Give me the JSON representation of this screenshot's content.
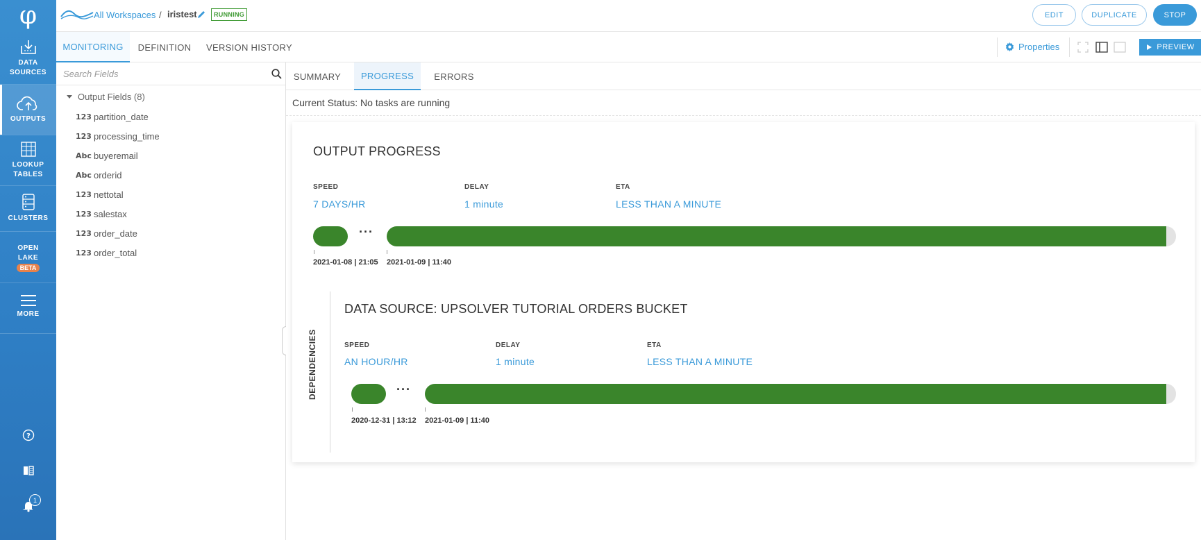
{
  "nav": {
    "logo_glyph": "φ",
    "items": [
      {
        "label": "DATA\nSOURCES",
        "icon": "data-sources-icon"
      },
      {
        "label": "OUTPUTS",
        "icon": "cloud-upload-icon",
        "active": true
      },
      {
        "label": "LOOKUP\nTABLES",
        "icon": "table-icon"
      },
      {
        "label": "CLUSTERS",
        "icon": "server-icon"
      },
      {
        "label": "OPEN\nLAKE",
        "badge": "BETA"
      },
      {
        "label": "MORE",
        "icon": "hamburger-icon"
      }
    ],
    "notification_count": "1"
  },
  "topbar": {
    "breadcrumb_link": "All Workspaces",
    "separator": "/",
    "name": "iristest",
    "status": "RUNNING",
    "status_color": "#3f9a34",
    "edit_label": "EDIT",
    "duplicate_label": "DUPLICATE",
    "stop_label": "STOP"
  },
  "main_tabs": [
    {
      "label": "MONITORING",
      "active": true
    },
    {
      "label": "DEFINITION"
    },
    {
      "label": "VERSION HISTORY"
    }
  ],
  "toolbar": {
    "properties_label": "Properties",
    "preview_label": "PREVIEW"
  },
  "fields_panel": {
    "search_placeholder": "Search Fields",
    "group_label": "Output Fields (8)",
    "fields": [
      {
        "type": "123",
        "name": "partition_date"
      },
      {
        "type": "123",
        "name": "processing_time"
      },
      {
        "type": "Abc",
        "name": "buyeremail"
      },
      {
        "type": "Abc",
        "name": "orderid"
      },
      {
        "type": "123",
        "name": "nettotal"
      },
      {
        "type": "123",
        "name": "salestax"
      },
      {
        "type": "123",
        "name": "order_date"
      },
      {
        "type": "123",
        "name": "order_total"
      }
    ]
  },
  "sub_tabs": [
    {
      "label": "SUMMARY"
    },
    {
      "label": "PROGRESS",
      "active": true
    },
    {
      "label": "ERRORS"
    }
  ],
  "current_status": "Current Status: No tasks are running",
  "output_progress": {
    "title": "OUTPUT PROGRESS",
    "speed_label": "SPEED",
    "speed_value": "7 DAYS/HR",
    "delay_label": "DELAY",
    "delay_value": "1  minute",
    "eta_label": "ETA",
    "eta_value": "LESS THAN A MINUTE",
    "ellipsis": "···",
    "start_time": "2021-01-08 | 21:05",
    "end_time": "2021-01-09 | 11:40",
    "progress_fraction": 0.99
  },
  "dependencies": {
    "label": "DEPENDENCIES",
    "title": "DATA SOURCE: UPSOLVER TUTORIAL ORDERS BUCKET",
    "speed_label": "SPEED",
    "speed_value": "AN HOUR/HR",
    "delay_label": "DELAY",
    "delay_value": "1  minute",
    "eta_label": "ETA",
    "eta_value": "LESS THAN A MINUTE",
    "ellipsis": "···",
    "start_time": "2020-12-31 | 13:12",
    "end_time": "2021-01-09 | 11:40",
    "progress_fraction": 0.99
  },
  "colors": {
    "accent": "#3a9ad9",
    "progress_green": "#3a852b",
    "nav_blue": "#2f7fc5"
  }
}
